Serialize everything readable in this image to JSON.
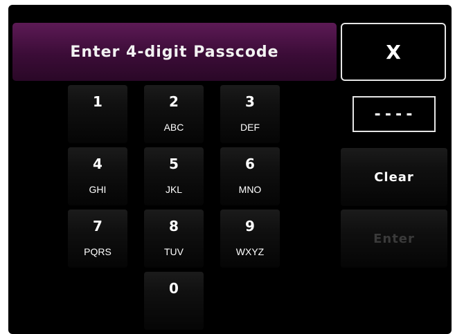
{
  "header": {
    "title": "Enter 4-digit Passcode",
    "close_label": "X"
  },
  "keypad": {
    "keys": [
      {
        "digit": "1",
        "letters": ""
      },
      {
        "digit": "2",
        "letters": "ABC"
      },
      {
        "digit": "3",
        "letters": "DEF"
      },
      {
        "digit": "4",
        "letters": "GHI"
      },
      {
        "digit": "5",
        "letters": "JKL"
      },
      {
        "digit": "6",
        "letters": "MNO"
      },
      {
        "digit": "7",
        "letters": "PQRS"
      },
      {
        "digit": "8",
        "letters": "TUV"
      },
      {
        "digit": "9",
        "letters": "WXYZ"
      },
      {
        "digit": "0",
        "letters": ""
      }
    ]
  },
  "passcode_display": {
    "value": "----"
  },
  "actions": {
    "clear_label": "Clear",
    "enter_label": "Enter",
    "enter_enabled": false
  },
  "colors": {
    "title_bar": "#4a1245",
    "background": "#000000",
    "text": "#ffffff",
    "disabled_text": "#3a3a3a"
  }
}
